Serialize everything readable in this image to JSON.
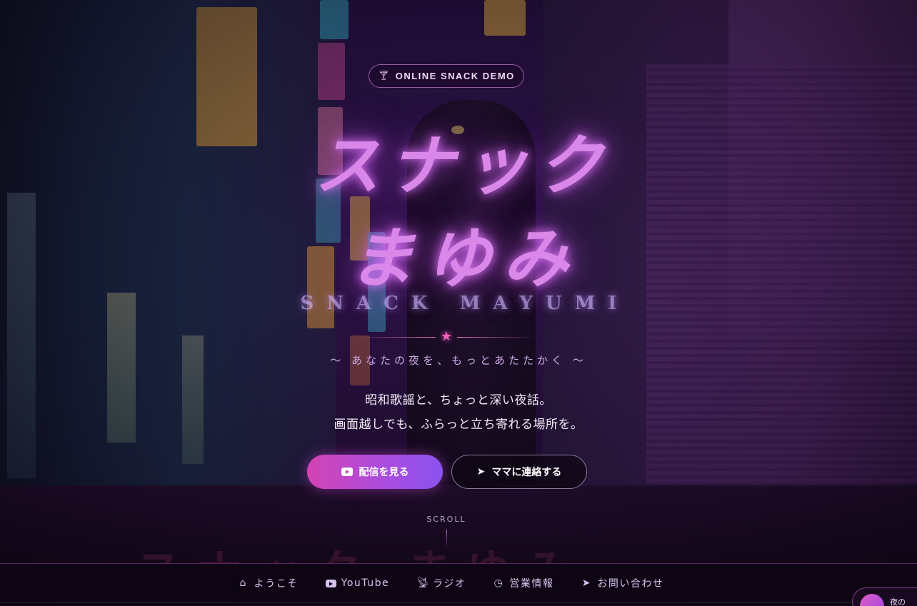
{
  "badge": {
    "icon": "cocktail-icon",
    "text": "ONLINE SNACK DEMO"
  },
  "hero": {
    "title_line1": "スナック",
    "title_line2": "まゆみ",
    "title_en": "SNACK MAYUMI",
    "divider_icon": "star-icon",
    "tagline": "〜 あなたの夜を、もっとあたたかく 〜",
    "description_line1": "昭和歌謡と、ちょっと深い夜話。",
    "description_line2": "画面越しでも、ふらっと立ち寄れる場所を。"
  },
  "buttons": {
    "primary": {
      "label": "配信を見る",
      "icon": "youtube-icon"
    },
    "secondary": {
      "label": "ママに連絡する",
      "icon": "paper-plane-icon"
    }
  },
  "scroll": {
    "label": "SCROLL"
  },
  "nav": {
    "items": [
      {
        "label": "ようこそ",
        "icon": "home-icon"
      },
      {
        "label": "YouTube",
        "icon": "youtube-icon"
      },
      {
        "label": "ラジオ",
        "icon": "broadcast-icon"
      },
      {
        "label": "営業情報",
        "icon": "clock-icon"
      },
      {
        "label": "お問い合わせ",
        "icon": "paper-plane-icon"
      }
    ]
  },
  "floating_chip": {
    "text": "夜の"
  },
  "colors": {
    "accent_pink": "#d444b4",
    "accent_purple": "#8a52f0",
    "title_glow": "#d987e8",
    "nav_text": "#d6c3ec"
  }
}
